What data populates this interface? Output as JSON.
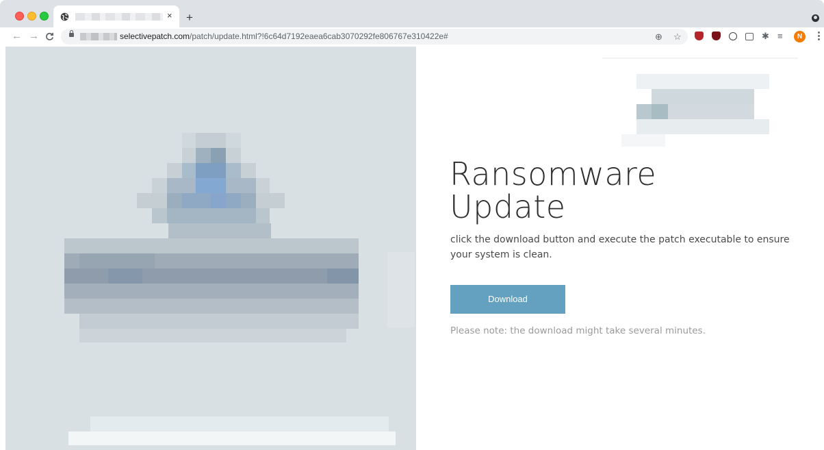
{
  "browser": {
    "tab": {
      "title": "",
      "close_glyph": "×"
    },
    "new_tab_glyph": "+",
    "nav": {
      "back_glyph": "←",
      "forward_glyph": "→",
      "reload_glyph": "C"
    },
    "address": {
      "domain": "selectivepatch.com",
      "path": "/patch/update.html?!6c64d7192eaea6cab3070292fe806767e310422e#"
    },
    "omnibox_icons": {
      "zoom": "⊕",
      "bookmark": "☆"
    },
    "toolbar_icons": {
      "extensions": "✱",
      "reading_list": "≡",
      "menu": "⋮"
    },
    "profile_initial": "N",
    "colors": {
      "tabstrip": "#dee1e6",
      "profile": "#f57c00"
    }
  },
  "page": {
    "headline_line1": "Ransomware",
    "headline_line2": "Update",
    "description": "click the download button and execute the patch executable to ensure your system is clean.",
    "download_label": "Download",
    "note": "Please note: the download might take several minutes.",
    "colors": {
      "button": "#64a0bf",
      "hero_background": "#d9e0e3"
    }
  }
}
